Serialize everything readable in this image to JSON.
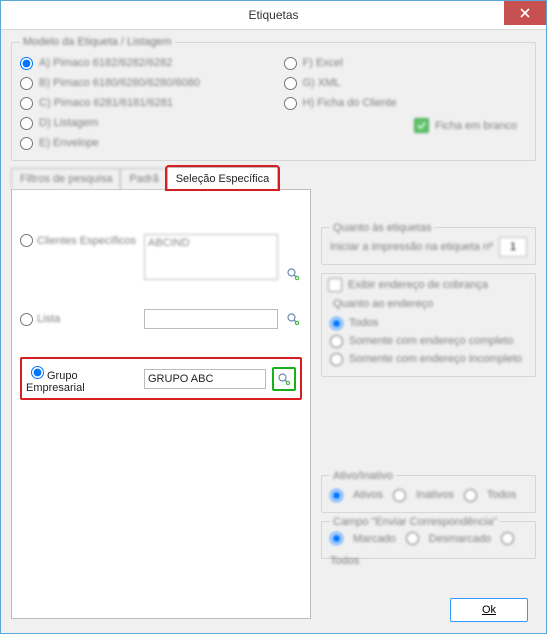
{
  "title": "Etiquetas",
  "model": {
    "legend": "Modelo da Etiqueta / Listagem",
    "left": [
      {
        "id": "a",
        "label": "A) Pimaco 6182/6282/6282",
        "checked": true
      },
      {
        "id": "b",
        "label": "B) Pimaco 6180/6280/6280/6080",
        "checked": false
      },
      {
        "id": "c",
        "label": "C) Pimaco 6281/6181/6281",
        "checked": false
      },
      {
        "id": "d",
        "label": "D) Listagem",
        "checked": false
      },
      {
        "id": "e",
        "label": "E) Envelope",
        "checked": false
      }
    ],
    "right": [
      {
        "id": "f",
        "label": "F) Excel",
        "checked": false
      },
      {
        "id": "g",
        "label": "G) XML",
        "checked": false
      },
      {
        "id": "h",
        "label": "H) Ficha do Cliente",
        "checked": false
      }
    ],
    "checkbox_label": "Ficha em branco"
  },
  "tabs": {
    "t1": "Filtros de pesquisa",
    "t2": "Padrã",
    "t3": "Seleção Específica"
  },
  "left_pane": {
    "clientes_label": "Clientes Específicos",
    "clientes_value": "ABCIND",
    "lista_label": "Lista",
    "lista_value": "",
    "grupo_label": "Grupo Empresarial",
    "grupo_value": "GRUPO ABC"
  },
  "right_pane": {
    "g1_title": "Quanto às etiquetas",
    "g1_line": "Iniciar a impressão na etiqueta nº",
    "g1_value": "1",
    "exibe_label": "Exibir endereço de cobrança",
    "g2_title": "Quanto ao endereço",
    "g2_opts": [
      "Todos",
      "Somente com endereço completo",
      "Somente com endereço incompleto"
    ],
    "g3_title": "Ativo/Inativo",
    "g3_opts": [
      "Ativos",
      "Inativos",
      "Todos"
    ],
    "g4_title": "Campo \"Enviar Correspondência\"",
    "g4_opts": [
      "Marcado",
      "Desmarcado",
      "Todos"
    ]
  },
  "ok_label": "Ok"
}
